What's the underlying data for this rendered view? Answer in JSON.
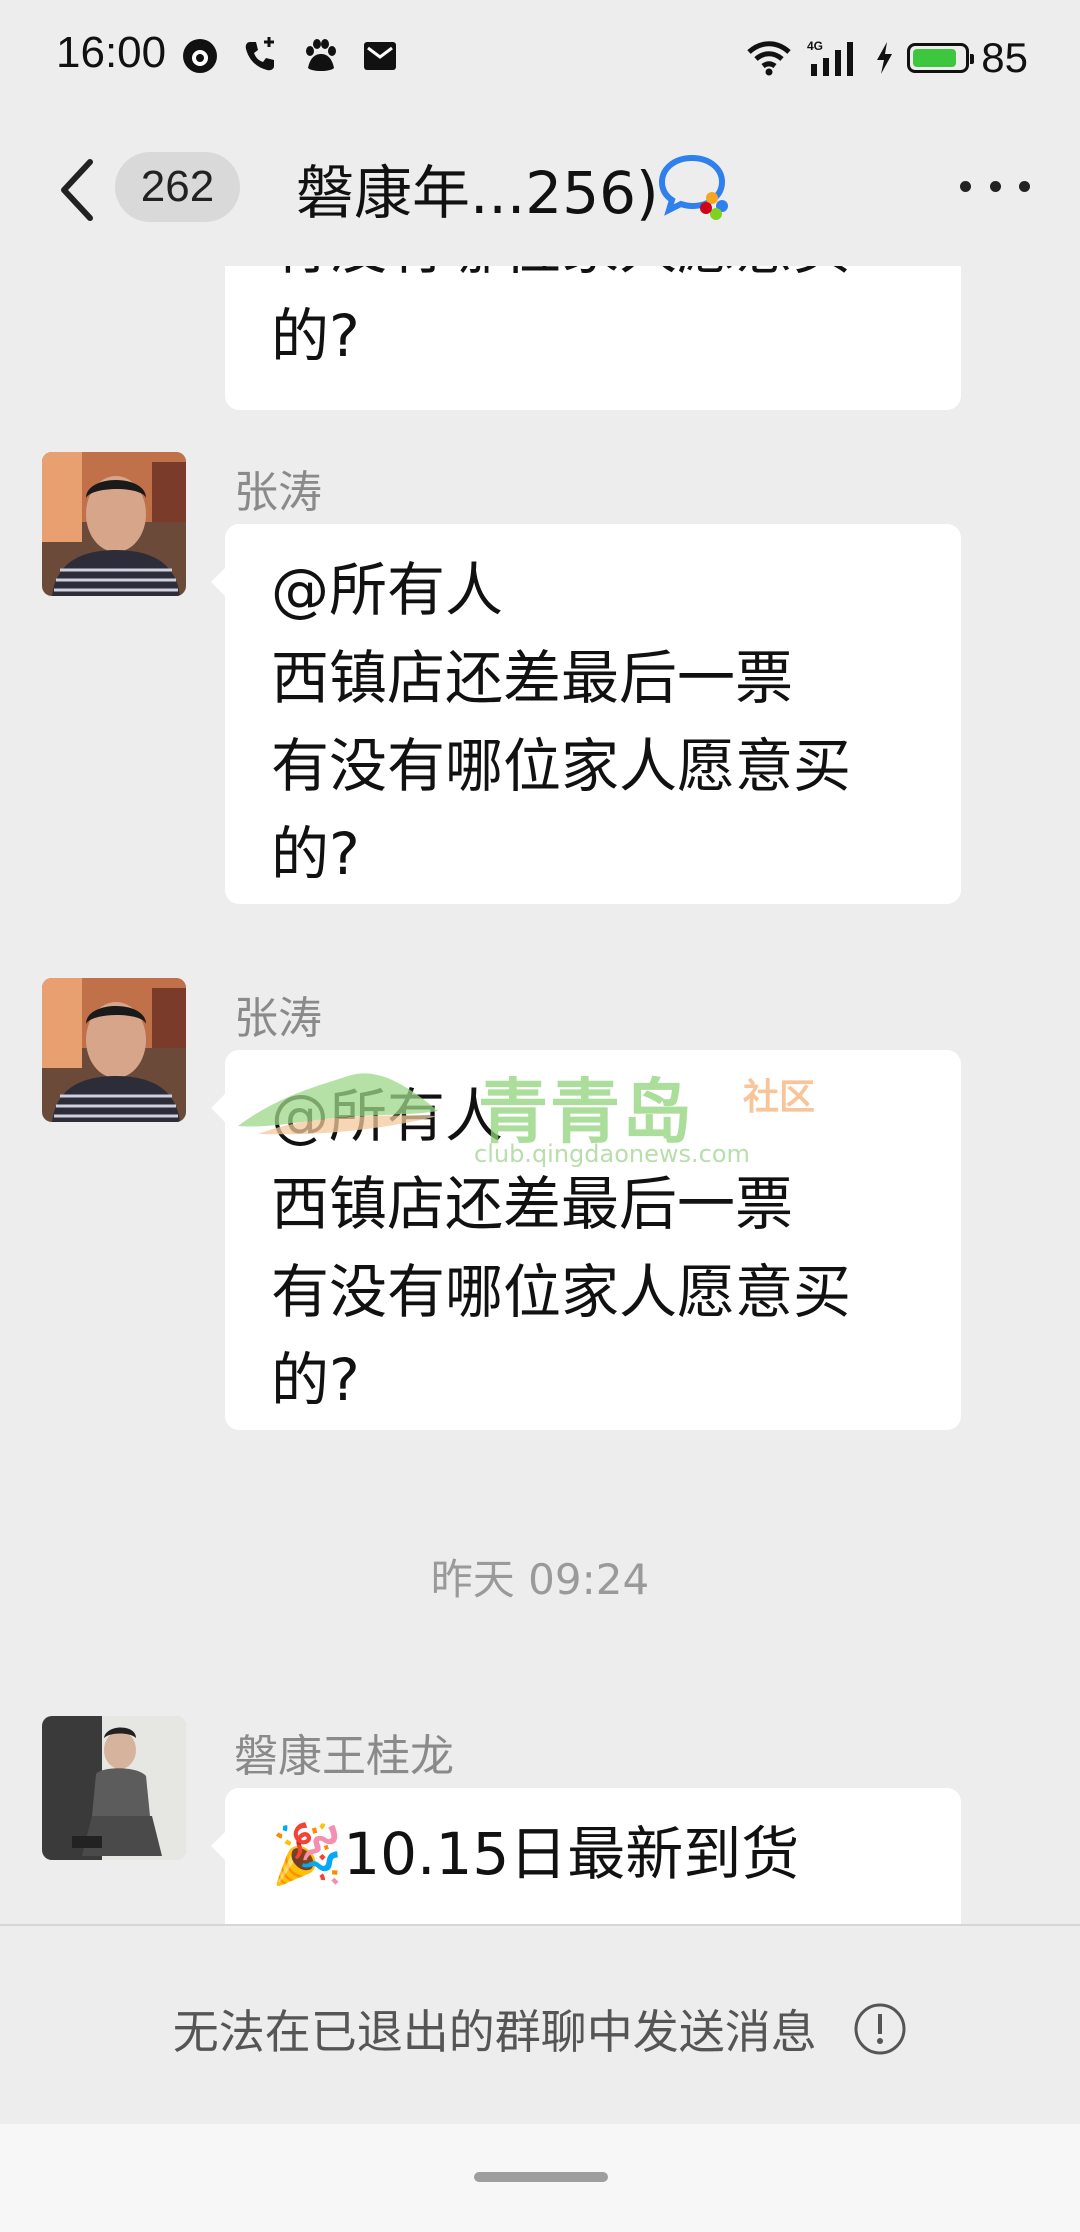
{
  "status_bar": {
    "time": "16:00",
    "battery": "85",
    "battery_level": 0.85,
    "network": "4G"
  },
  "header": {
    "unread_count": "262",
    "title": "磐康年...256)",
    "accent_color": "#2f80ed"
  },
  "messages": [
    {
      "sender": "",
      "lines": [
        "有没有哪位家人愿意买",
        "的?"
      ]
    },
    {
      "sender": "张涛",
      "lines": [
        "@所有人",
        "西镇店还差最后一票",
        "有没有哪位家人愿意买",
        "的?"
      ]
    },
    {
      "sender": "张涛",
      "lines": [
        "@所有人",
        "西镇店还差最后一票",
        "有没有哪位家人愿意买",
        "的?"
      ]
    },
    {
      "timestamp": "昨天 09:24"
    },
    {
      "sender": "磐康王桂龙",
      "lines": [
        "🎉10.15日最新到货"
      ]
    }
  ],
  "watermark": {
    "title": "青青岛",
    "tag": "社区",
    "url": "club.qingdaonews.com"
  },
  "footer": {
    "message": "无法在已退出的群聊中发送消息"
  },
  "icons": [
    "back-icon",
    "wechat-work-icon",
    "more-icon",
    "info-icon",
    "wifi-icon",
    "signal-icon",
    "battery-icon",
    "charging-icon",
    "phone-icon",
    "baidu-paw-icon",
    "mail-icon",
    "avatar-icon"
  ]
}
